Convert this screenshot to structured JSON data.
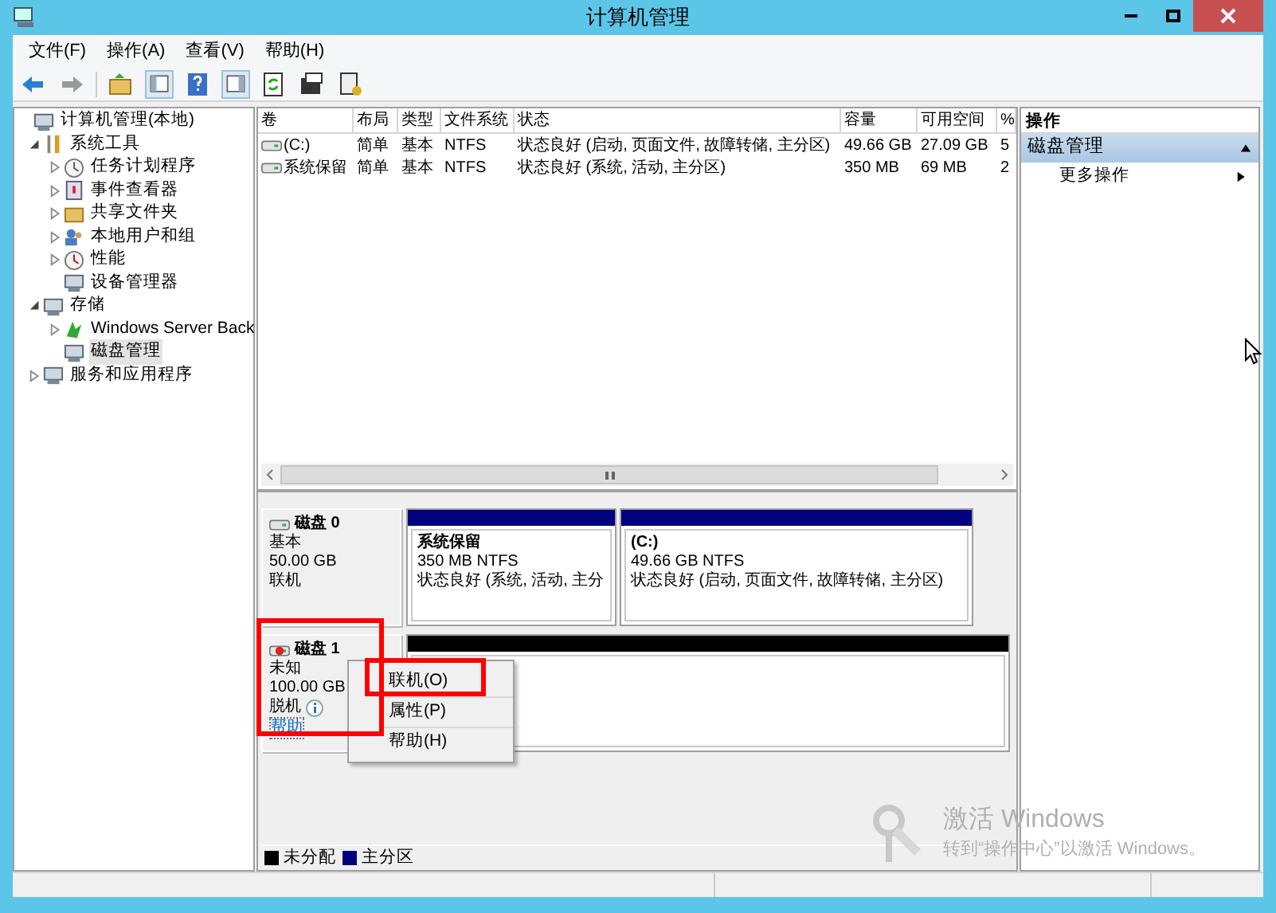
{
  "window": {
    "title": "计算机管理"
  },
  "menu": [
    "文件(F)",
    "操作(A)",
    "查看(V)",
    "帮助(H)"
  ],
  "tree": [
    {
      "label": "计算机管理(本地)",
      "selected": false,
      "children": [
        {
          "label": "系统工具",
          "expanded": true,
          "selected": false,
          "children": [
            {
              "label": "任务计划程序",
              "expanded": false,
              "selected": false
            },
            {
              "label": "事件查看器",
              "expanded": false,
              "selected": false
            },
            {
              "label": "共享文件夹",
              "expanded": false,
              "selected": false
            },
            {
              "label": "本地用户和组",
              "expanded": false,
              "selected": false
            },
            {
              "label": "性能",
              "expanded": false,
              "selected": false
            },
            {
              "label": "设备管理器",
              "selected": false
            }
          ]
        },
        {
          "label": "存储",
          "expanded": true,
          "selected": false,
          "children": [
            {
              "label": "Windows Server Back",
              "expanded": false,
              "selected": false
            },
            {
              "label": "磁盘管理",
              "selected": true
            }
          ]
        },
        {
          "label": "服务和应用程序",
          "expanded": false,
          "selected": false
        }
      ]
    }
  ],
  "table": {
    "columns": [
      "卷",
      "布局",
      "类型",
      "文件系统",
      "状态",
      "容量",
      "可用空间",
      "%"
    ],
    "rows": [
      [
        "(C:)",
        "简单",
        "基本",
        "NTFS",
        "状态良好 (启动, 页面文件, 故障转储, 主分区)",
        "49.66 GB",
        "27.09 GB",
        "5"
      ],
      [
        "系统保留",
        "简单",
        "基本",
        "NTFS",
        "状态良好 (系统, 活动, 主分区)",
        "350 MB",
        "69 MB",
        "2"
      ]
    ]
  },
  "disks": [
    {
      "name": "磁盘 0",
      "type": "基本",
      "size": "50.00 GB",
      "status": "联机",
      "offline": false,
      "partitions": [
        {
          "name": "系统保留",
          "detail": "350 MB NTFS",
          "status": "状态良好 (系统, 活动, 主分",
          "color": "#00007f"
        },
        {
          "name": "(C:)",
          "detail": "49.66 GB NTFS",
          "status": "状态良好 (启动, 页面文件, 故障转储, 主分区)",
          "color": "#00007f"
        }
      ]
    },
    {
      "name": "磁盘 1",
      "type": "未知",
      "size": "100.00 GB",
      "status": "脱机",
      "offline": true,
      "help_link": "帮助",
      "partitions": [
        {
          "color": "#000000"
        }
      ]
    }
  ],
  "context_menu": [
    "联机(O)",
    "属性(P)",
    "帮助(H)"
  ],
  "legend": [
    {
      "label": "未分配",
      "color": "#000000"
    },
    {
      "label": "主分区",
      "color": "#00007f"
    }
  ],
  "actions": {
    "header": "操作",
    "section": {
      "title": "磁盘管理",
      "expanded": true
    },
    "items": [
      "更多操作"
    ]
  },
  "activation": {
    "title": "激活 Windows",
    "subtitle": "转到“操作中心”以激活 Windows。"
  }
}
